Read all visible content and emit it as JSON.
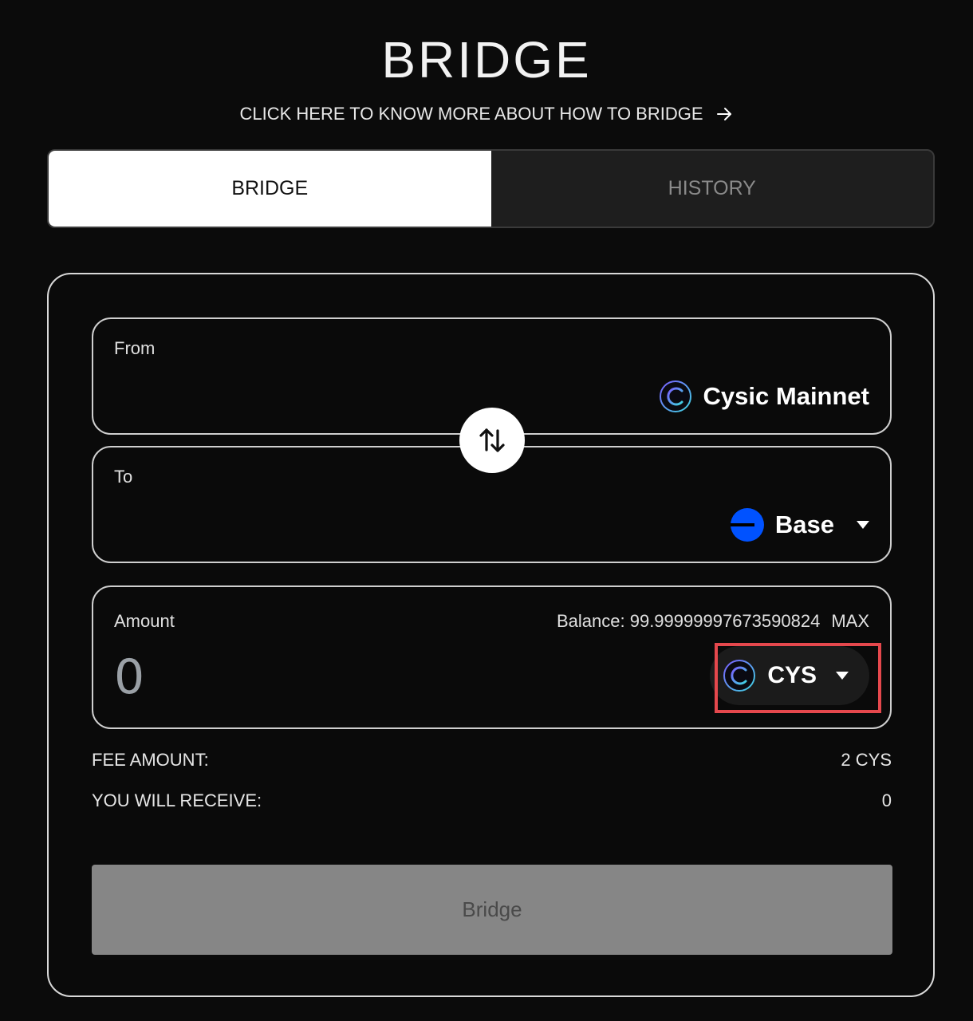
{
  "header": {
    "title": "BRIDGE",
    "help_link": "CLICK HERE TO KNOW MORE ABOUT HOW TO BRIDGE"
  },
  "tabs": [
    {
      "label": "BRIDGE",
      "active": true
    },
    {
      "label": "HISTORY",
      "active": false
    }
  ],
  "from": {
    "label": "From",
    "network": "Cysic Mainnet",
    "icon": "cysic-logo-icon"
  },
  "to": {
    "label": "To",
    "network": "Base",
    "icon": "base-logo-icon"
  },
  "amount": {
    "label": "Amount",
    "balance_text": "Balance: 99.99999997673590824",
    "max_label": "MAX",
    "value": "0",
    "token": "CYS"
  },
  "fee": {
    "label": "FEE AMOUNT:",
    "value": "2 CYS"
  },
  "receive": {
    "label": "YOU WILL RECEIVE:",
    "value": "0"
  },
  "submit": {
    "label": "Bridge"
  },
  "colors": {
    "background": "#0b0b0b",
    "highlight": "#e5484d",
    "base_blue": "#0052ff",
    "disabled_button": "#868686"
  }
}
